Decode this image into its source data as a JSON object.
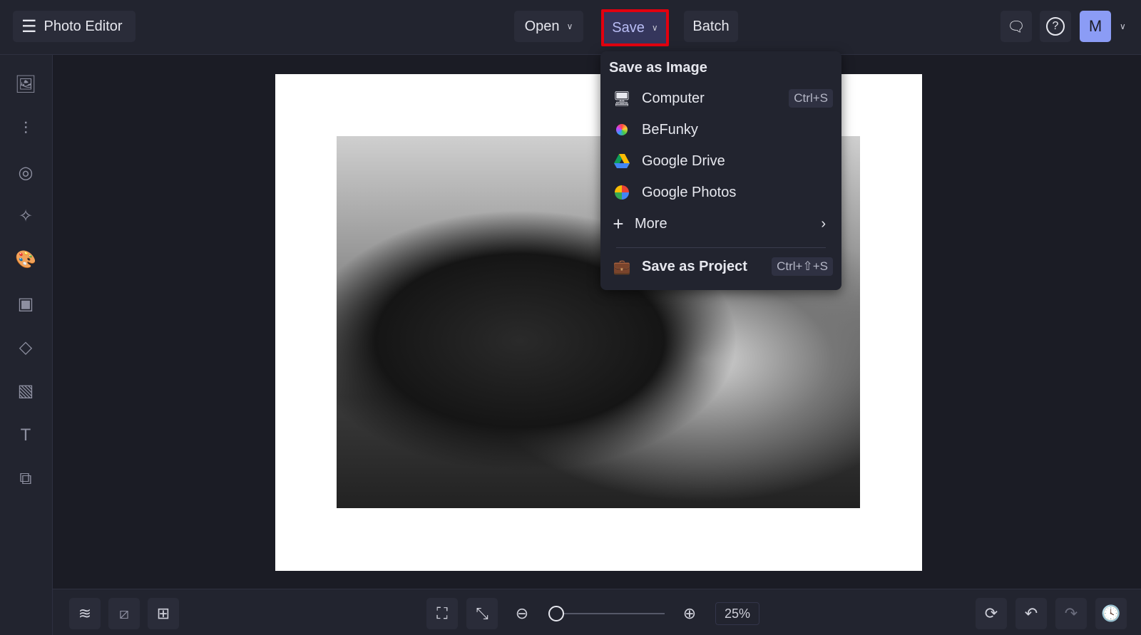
{
  "header": {
    "title": "Photo Editor",
    "open_label": "Open",
    "save_label": "Save",
    "batch_label": "Batch",
    "avatar_initial": "M"
  },
  "save_menu": {
    "heading": "Save as Image",
    "items": [
      {
        "label": "Computer",
        "shortcut": "Ctrl+S"
      },
      {
        "label": "BeFunky"
      },
      {
        "label": "Google Drive"
      },
      {
        "label": "Google Photos"
      },
      {
        "label": "More"
      }
    ],
    "project": {
      "label": "Save as Project",
      "shortcut": "Ctrl+⇧+S"
    }
  },
  "bottom": {
    "zoom": "25%",
    "zoom_slider_fraction": 0.05
  },
  "colors": {
    "highlight": "#e3000f",
    "avatar": "#8b9cf5",
    "save_bg": "#35365c"
  }
}
